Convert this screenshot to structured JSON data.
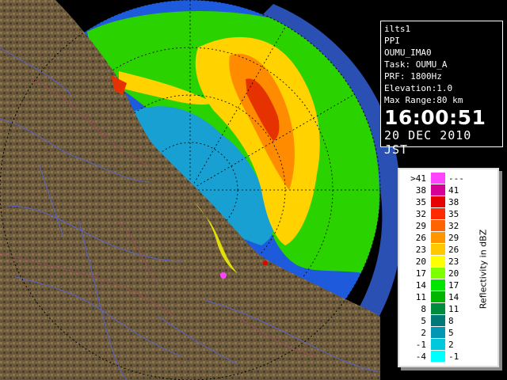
{
  "radar": {
    "site": "ilts1",
    "product": "PPI",
    "source": "OUMU_IMA0",
    "task": "Task: OUMU_A",
    "prf": "PRF: 1800Hz",
    "elevation": "Elevation:1.0",
    "max_range": "Max Range:80 km",
    "time": "16:00:51",
    "date": "20 DEC 2010 JST"
  },
  "legend": {
    "title": "Reflectivity in dBZ",
    "rows": [
      {
        "lo": ">41",
        "hi": "---",
        "color": "#ff44ff"
      },
      {
        "lo": "38",
        "hi": "41",
        "color": "#d60096"
      },
      {
        "lo": "35",
        "hi": "38",
        "color": "#e60000"
      },
      {
        "lo": "32",
        "hi": "35",
        "color": "#ff2a00"
      },
      {
        "lo": "29",
        "hi": "32",
        "color": "#ff6400"
      },
      {
        "lo": "26",
        "hi": "29",
        "color": "#ff9600"
      },
      {
        "lo": "23",
        "hi": "26",
        "color": "#ffc800"
      },
      {
        "lo": "20",
        "hi": "23",
        "color": "#ffff00"
      },
      {
        "lo": "17",
        "hi": "20",
        "color": "#7dff00"
      },
      {
        "lo": "14",
        "hi": "17",
        "color": "#00e600"
      },
      {
        "lo": "11",
        "hi": "14",
        "color": "#00b400"
      },
      {
        "lo": "8",
        "hi": "11",
        "color": "#008c3c"
      },
      {
        "lo": "5",
        "hi": "8",
        "color": "#007878"
      },
      {
        "lo": "2",
        "hi": "5",
        "color": "#0096b4"
      },
      {
        "lo": "-1",
        "hi": "2",
        "color": "#00c8dc"
      },
      {
        "lo": "-4",
        "hi": "-1",
        "color": "#00ffff"
      }
    ]
  },
  "colors": {
    "sea": "#1e5adc",
    "land": "#6e5a3c",
    "rivers": "#5a64c8",
    "range_rings": "#000000"
  }
}
